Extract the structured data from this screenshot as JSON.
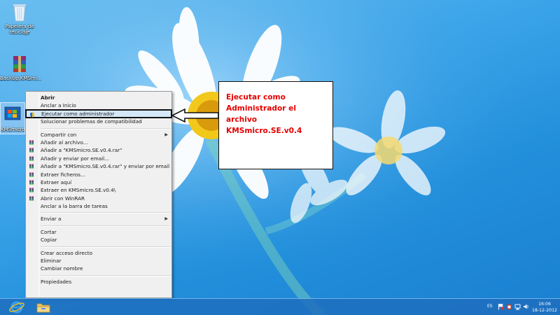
{
  "desktop": {
    "icons": [
      {
        "label": "Papelera de reciclaje",
        "icon": "recycle-bin-icon"
      },
      {
        "label": "BackUp.KMSmi...",
        "icon": "winrar-archive-icon"
      },
      {
        "label": "KMSmicro.SE.v0.4",
        "icon": "windows-app-icon"
      }
    ]
  },
  "context_menu": {
    "items": [
      {
        "label": "Abrir",
        "bold": true
      },
      {
        "label": "Anclar a Inicio"
      },
      {
        "label": "Ejecutar como administrador",
        "icon": "admin-shield-icon",
        "selected": true
      },
      {
        "label": "Solucionar problemas de compatibilidad"
      },
      {
        "sep": true
      },
      {
        "label": "Compartir con",
        "submenu": true
      },
      {
        "label": "Añadir al archivo...",
        "icon": "winrar-icon"
      },
      {
        "label": "Añadir a \"KMSmicro.SE.v0.4.rar\"",
        "icon": "winrar-icon"
      },
      {
        "label": "Añadir y enviar por email...",
        "icon": "winrar-icon"
      },
      {
        "label": "Añadir a \"KMSmicro.SE.v0.4.rar\" y enviar por email",
        "icon": "winrar-icon"
      },
      {
        "label": "Extraer ficheros...",
        "icon": "winrar-icon"
      },
      {
        "label": "Extraer aquí",
        "icon": "winrar-icon"
      },
      {
        "label": "Extraer en KMSmicro.SE.v0.4\\",
        "icon": "winrar-icon"
      },
      {
        "label": "Abrir con WinRAR",
        "icon": "winrar-icon"
      },
      {
        "label": "Anclar a la barra de tareas"
      },
      {
        "sep": true
      },
      {
        "label": "Enviar a",
        "submenu": true
      },
      {
        "sep": true
      },
      {
        "label": "Cortar"
      },
      {
        "label": "Copiar"
      },
      {
        "sep": true
      },
      {
        "label": "Crear acceso directo"
      },
      {
        "label": "Eliminar"
      },
      {
        "label": "Cambiar nombre"
      },
      {
        "sep": true
      },
      {
        "label": "Propiedades"
      }
    ]
  },
  "annotation": {
    "lines": [
      "Ejecutar como",
      "Administrador el archivo",
      "KMSmicro.SE.v0.4"
    ],
    "color": "#e60000"
  },
  "taskbar": {
    "pinned": [
      "internet-explorer-icon",
      "file-explorer-icon"
    ],
    "tray_lang": "ES",
    "clock_time": "16:06",
    "clock_date": "18-12-2012"
  },
  "colors": {
    "wallpaper": "#2390dc",
    "menu_bg": "#f0f0f0",
    "menu_highlight": "#d5e8f8"
  }
}
